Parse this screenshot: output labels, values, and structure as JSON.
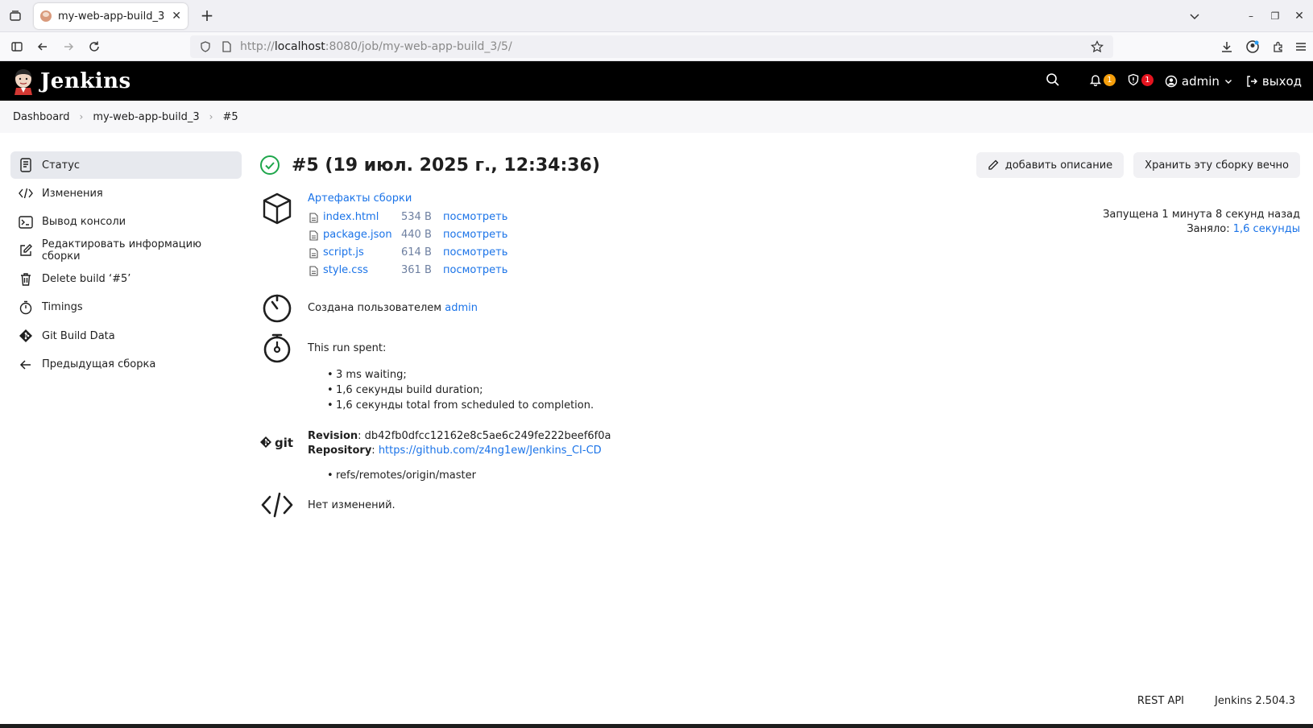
{
  "browser": {
    "tab_title": "my-web-app-build_3 #",
    "url_prefix": "http://",
    "url_host": "localhost",
    "url_rest": ":8080/job/my-web-app-build_3/5/"
  },
  "header": {
    "logo_text": "Jenkins",
    "notifications_count": "1",
    "security_count": "1",
    "user": "admin",
    "logout": "выход"
  },
  "breadcrumb": [
    "Dashboard",
    "my-web-app-build_3",
    "#5"
  ],
  "sidebar": {
    "items": [
      {
        "label": "Статус",
        "icon": "document-icon"
      },
      {
        "label": "Изменения",
        "icon": "code-icon"
      },
      {
        "label": "Вывод консоли",
        "icon": "terminal-icon"
      },
      {
        "label": "Редактировать информацию сборки",
        "icon": "edit-icon"
      },
      {
        "label": "Delete build ‘#5’",
        "icon": "trash-icon"
      },
      {
        "label": "Timings",
        "icon": "stopwatch-icon"
      },
      {
        "label": "Git Build Data",
        "icon": "git-icon"
      },
      {
        "label": "Предыдущая сборка",
        "icon": "arrow-left-icon"
      }
    ]
  },
  "build": {
    "title": "#5 (19 июл. 2025 г., 12:34:36)",
    "add_description": "добавить описание",
    "keep_forever": "Хранить эту сборку вечно",
    "started": "Запущена 1 минута 8 секунд назад",
    "took_label": "Заняло: ",
    "took_value": "1,6 секунды"
  },
  "artifacts": {
    "title": "Артефакты сборки",
    "view_label": "посмотреть",
    "files": [
      {
        "name": "index.html",
        "size": "534 B"
      },
      {
        "name": "package.json",
        "size": "440 B"
      },
      {
        "name": "script.js",
        "size": "614 B"
      },
      {
        "name": "style.css",
        "size": "361 B"
      }
    ]
  },
  "cause": {
    "text": "Создана пользователем ",
    "user": "admin"
  },
  "timing": {
    "heading": "This run spent:",
    "items": [
      "3 ms waiting;",
      "1,6 секунды build duration;",
      "1,6 секунды total from scheduled to completion."
    ]
  },
  "git": {
    "logo_text": "git",
    "revision_label": "Revision",
    "revision": "db42fb0dfcc12162e8c5ae6c249fe222beef6f0a",
    "repository_label": "Repository",
    "repository": "https://github.com/z4ng1ew/Jenkins_CI-CD",
    "refs": [
      "refs/remotes/origin/master"
    ]
  },
  "changes": {
    "text": "Нет изменений."
  },
  "footer": {
    "rest_api": "REST API",
    "version": "Jenkins 2.504.3"
  },
  "colors": {
    "link": "#1a73e8",
    "success": "#1ea64b",
    "header_bg": "#000000"
  }
}
